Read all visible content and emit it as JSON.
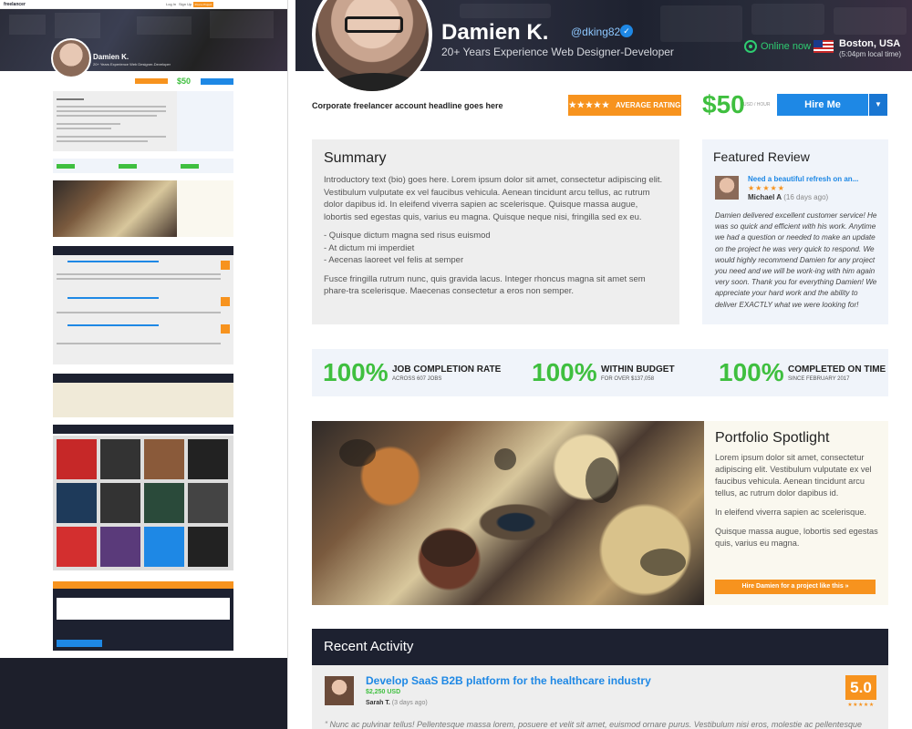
{
  "profile": {
    "name": "Damien K.",
    "handle": "@dking82",
    "tagline": "20+ Years Experience Web Designer-Developer",
    "status": "Online now",
    "location": "Boston, USA",
    "local_time": "(5:04pm local time)",
    "headline": "Corporate freelancer account headline goes here"
  },
  "actions": {
    "rating_stars": "★★★★★",
    "rating_label": "AVERAGE RATING",
    "price": "$50",
    "price_unit": "USD / HOUR",
    "hire_label": "Hire Me",
    "hire_dropdown_icon": "▼"
  },
  "summary": {
    "title": "Summary",
    "intro": "Introductory text (bio) goes  here. Lorem ipsum dolor sit amet, consectetur adipiscing elit. Vestibulum vulputate ex vel faucibus vehicula. Aenean tincidunt arcu tellus, ac rutrum dolor dapibus id. In eleifend viverra sapien ac scelerisque. Quisque massa augue, lobortis sed egestas quis, varius eu magna. Quisque neque nisi, fringilla sed ex eu.",
    "bullets": [
      "- Quisque dictum magna sed risus euismod",
      "- At dictum mi imperdiet",
      "- Aecenas laoreet vel felis at semper"
    ],
    "outro": "Fusce fringilla rutrum nunc, quis gravida lacus. Integer rhoncus magna sit amet sem phare-tra scelerisque. Maecenas consectetur a eros non semper."
  },
  "featured_review": {
    "title": "Featured Review",
    "review_title": "Need a beautiful refresh on an...",
    "stars": "★★★★★",
    "author": "Michael A",
    "time": " (16 days ago)",
    "text": "Damien delivered excellent customer service! He was so quick and efficient with his work. Anytime we had a question or needed to make an update on the project he was very quick to respond. We would highly recommend Damien for any project you need and we will be work-ing with him again very soon. Thank you for everything Damien! We appreciate your hard work and the ability to deliver EXACTLY what we were looking for!"
  },
  "stats": [
    {
      "pct": "100%",
      "label": "JOB COMPLETION RATE",
      "sub": "ACROSS 607 JOBS",
      "percent_value": 100
    },
    {
      "pct": "100%",
      "label": "WITHIN BUDGET",
      "sub": "FOR OVER $137,058",
      "percent_value": 100
    },
    {
      "pct": "100%",
      "label": "COMPLETED ON TIME",
      "sub": "SINCE FEBRUARY 2017",
      "percent_value": 100
    }
  ],
  "portfolio": {
    "title": "Portfolio Spotlight",
    "p1": "Lorem ipsum dolor sit amet, consectetur adipiscing elit. Vestibulum vulputate ex vel faucibus vehicula. Aenean tincidunt arcu tellus, ac rutrum dolor dapibus id.",
    "p2": "In eleifend viverra sapien ac scelerisque.",
    "p3": "Quisque massa augue, lobortis sed egestas quis, varius eu magna.",
    "button": "Hire Damien for a project like this »"
  },
  "recent_activity": {
    "title": "Recent Activity",
    "items": [
      {
        "title": "Develop SaaS B2B platform for the healthcare industry",
        "budget": "$2,250 USD",
        "author": "Sarah T.",
        "time": " (3 days ago)",
        "score": "5.0",
        "stars": "★★★★★",
        "quote": "“ Nunc ac pulvinar tellus! Pellentesque massa lorem, posuere et velit sit amet, euismod ornare purus. Vestibulum nisi eros, molestie ac pellentesque"
      }
    ]
  },
  "thumbnail": {
    "logo": "freelancer",
    "nav": [
      "Log In",
      "Sign Up"
    ],
    "post_button": "Post a Project"
  },
  "colors": {
    "accent_orange": "#f7931e",
    "accent_blue": "#1e88e5",
    "accent_green": "#3fbf3f",
    "dark": "#1d2130"
  }
}
